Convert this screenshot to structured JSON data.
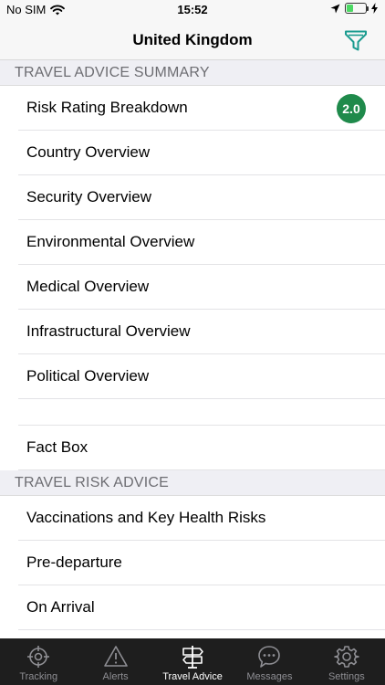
{
  "status_bar": {
    "carrier": "No SIM",
    "time": "15:52",
    "battery_level": 0.35
  },
  "nav": {
    "title": "United Kingdom",
    "filter_icon": "filter-icon"
  },
  "sections": {
    "summary_header": "TRAVEL ADVICE SUMMARY",
    "summary_items": [
      "Risk Rating Breakdown",
      "Country Overview",
      "Security Overview",
      "Environmental Overview",
      "Medical Overview",
      "Infrastructural Overview",
      "Political Overview"
    ],
    "risk_rating_value": "2.0",
    "fact_box": "Fact Box",
    "risk_advice_header": "TRAVEL RISK ADVICE",
    "risk_advice_items": [
      "Vaccinations and Key Health Risks",
      "Pre-departure",
      "On Arrival"
    ]
  },
  "tabs": [
    {
      "label": "Tracking",
      "icon": "crosshair-icon"
    },
    {
      "label": "Alerts",
      "icon": "warning-icon"
    },
    {
      "label": "Travel Advice",
      "icon": "signpost-icon"
    },
    {
      "label": "Messages",
      "icon": "chat-bubble-icon"
    },
    {
      "label": "Settings",
      "icon": "gear-icon"
    }
  ],
  "colors": {
    "accent": "#1a9b8f",
    "badge": "#1f8a4b",
    "tab_bar": "#1e1e1e"
  },
  "active_tab": "Travel Advice"
}
